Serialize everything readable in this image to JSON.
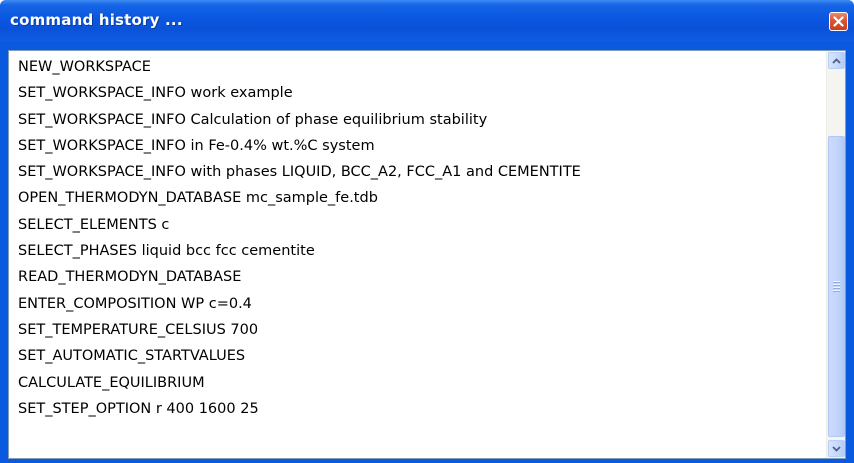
{
  "window": {
    "title": "command history ..."
  },
  "history": {
    "items": [
      "NEW_WORKSPACE",
      "SET_WORKSPACE_INFO work example",
      "SET_WORKSPACE_INFO Calculation of phase equilibrium stability",
      "SET_WORKSPACE_INFO in Fe-0.4% wt.%C system",
      "SET_WORKSPACE_INFO with phases LIQUID, BCC_A2, FCC_A1 and CEMENTITE",
      "OPEN_THERMODYN_DATABASE mc_sample_fe.tdb",
      "SELECT_ELEMENTS c",
      "SELECT_PHASES liquid bcc fcc cementite",
      "READ_THERMODYN_DATABASE",
      "ENTER_COMPOSITION WP c=0.4",
      "SET_TEMPERATURE_CELSIUS 700",
      "SET_AUTOMATIC_STARTVALUES",
      "CALCULATE_EQUILIBRIUM",
      "SET_STEP_OPTION r 400 1600 25"
    ]
  },
  "icons": {
    "close": "close-icon",
    "scroll_up": "chevron-up-icon",
    "scroll_down": "chevron-down-icon",
    "grip": "grip-icon"
  },
  "colors": {
    "titlebar": "#0a56e0",
    "close_button": "#dc5433",
    "scrollbar_thumb": "#c3d5fc"
  }
}
